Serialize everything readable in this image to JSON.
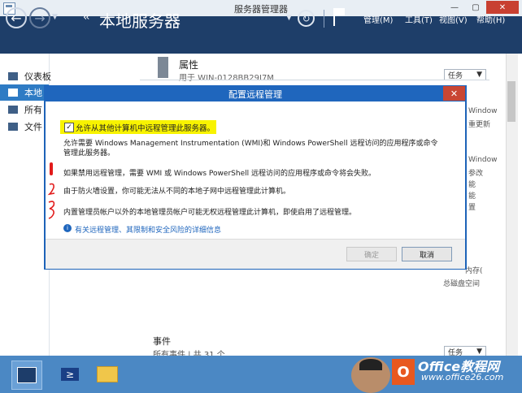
{
  "window": {
    "title": "服务器管理器",
    "buttons": {
      "minimize": "—",
      "maximize": "▢",
      "close": "✕"
    }
  },
  "header": {
    "title": "本地服务器",
    "breadcrumb_chevron": "‹‹",
    "menus": [
      {
        "label": "管理(M)"
      },
      {
        "label": "工具(T)"
      },
      {
        "label": "视图(V)"
      },
      {
        "label": "帮助(H)"
      }
    ]
  },
  "sidebar": {
    "items": [
      {
        "label": "仪表板",
        "selected": false
      },
      {
        "label": "本地",
        "selected": true
      },
      {
        "label": "所有",
        "selected": false
      },
      {
        "label": "文件",
        "selected": false
      }
    ]
  },
  "main": {
    "properties": {
      "title": "属性",
      "subtitle": "用于 WIN-0128BB29I7M"
    },
    "tasks_label": "任务",
    "side_fragments": [
      "Window",
      "重",
      "更新",
      "Window",
      "参",
      "改",
      "能",
      "能",
      "置"
    ],
    "right_snippets": {
      "memory": "内存(",
      "disk": "总磁盘空间"
    },
    "events": {
      "title": "事件",
      "subtitle": "所有事件 | 共 31 个"
    }
  },
  "dialog": {
    "title": "配置远程管理",
    "close": "✕",
    "checkbox": {
      "checked": true,
      "label": "允许从其他计算机中远程管理此服务器。"
    },
    "description_line1": "允许需要 Windows Management Instrumentation (WMI)和 Windows PowerShell 远程访问的应用程序或命令",
    "description_line2": "管理此服务器。",
    "notes": [
      "如果禁用远程管理，需要 WMI 或 Windows PowerShell 远程访问的应用程序或命令将会失败。",
      "由于防火墙设置，你可能无法从不同的本地子网中远程管理此计算机。",
      "内置管理员帐户以外的本地管理员帐户可能无权远程管理此计算机，即使启用了远程管理。"
    ],
    "info_link": "有关远程管理、其限制和安全风险的详细信息",
    "ok_label": "确定",
    "cancel_label": "取消"
  },
  "taskbar": {
    "apps": [
      {
        "name": "server-manager",
        "active": true
      },
      {
        "name": "powershell",
        "active": false
      },
      {
        "name": "file-explorer",
        "active": false
      }
    ],
    "powershell_glyph": "≥"
  },
  "watermark": {
    "line1": "Office教程网",
    "line2": "www.office26.com",
    "logo": "O"
  },
  "colors": {
    "header": "#1e3e69",
    "accent": "#1f66bd",
    "highlight": "#f8f300",
    "annotation": "#e21b1b",
    "taskbar": "#4b88c4"
  }
}
